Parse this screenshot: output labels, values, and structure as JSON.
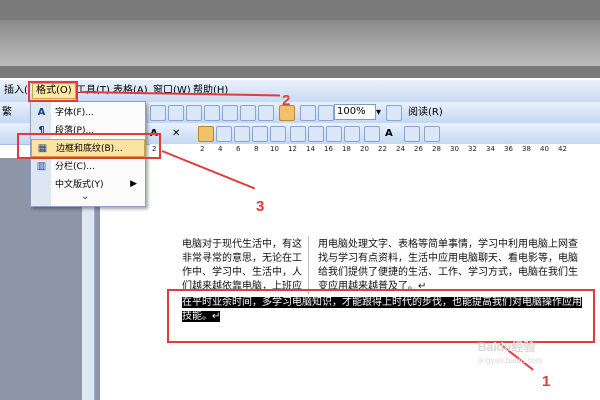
{
  "menubar": {
    "items": [
      {
        "label": "插入(I)",
        "active": false
      },
      {
        "label": "格式(O)",
        "active": true
      },
      {
        "label": "工具(T)",
        "active": false
      },
      {
        "label": "表格(A)",
        "active": false
      },
      {
        "label": "窗口(W)",
        "active": false
      },
      {
        "label": "帮助(H)",
        "active": false
      }
    ]
  },
  "toolbar": {
    "zoom": "100%",
    "read_label": "阅读(R)",
    "style_partial": "繁",
    "column_prefix": "A"
  },
  "format_menu": {
    "items": [
      {
        "icon": "A",
        "label": "字体(F)...",
        "highlighted": false,
        "submenu": false
      },
      {
        "icon": "¶",
        "label": "段落(P)...",
        "highlighted": false,
        "submenu": false
      },
      {
        "icon": "▦",
        "label": "边框和底纹(B)...",
        "highlighted": true,
        "submenu": false
      },
      {
        "icon": "▥",
        "label": "分栏(C)...",
        "highlighted": false,
        "submenu": false
      },
      {
        "icon": "",
        "label": "中文版式(Y)",
        "highlighted": false,
        "submenu": true
      }
    ],
    "expand_glyph": "⌄"
  },
  "ruler": {
    "ticks": [
      "2",
      "2",
      "4",
      "6",
      "8",
      "10",
      "12",
      "14",
      "16",
      "18",
      "20",
      "22",
      "24",
      "26",
      "28",
      "30",
      "32",
      "34",
      "36",
      "38",
      "40",
      "42"
    ]
  },
  "document": {
    "left_column": [
      "电脑对于现代生活中，有这",
      "非常寻常的意思，无论在工",
      "作中、学习中、生活中，人",
      "们越来越依靠电脑，上班应"
    ],
    "right_column": [
      "用电脑处理文字、表格等简单事情，学习中利用电脑上网查",
      "找与学习有点资料，生活中应用电脑聊天、看电影等，电脑",
      "给我们提供了便捷的生活、工作、学习方式，电脑在我们生",
      "变应用越来越普及了。↵"
    ],
    "selected_lines": [
      "在平时业余时间，多学习电脑知识，才能跟得上时代的步伐，也能提高我们对电脑操作应用",
      "技能。↵"
    ]
  },
  "annotations": {
    "step1": "1",
    "step2": "2",
    "step3": "3"
  },
  "watermark": {
    "line1": "Baidu经验",
    "line2": "jingyan.baidu.com"
  },
  "colors": {
    "annotation_red": "#e23b3b",
    "menu_highlight": "#fde3a0",
    "toolbar_blue": "#c4d8f2"
  }
}
